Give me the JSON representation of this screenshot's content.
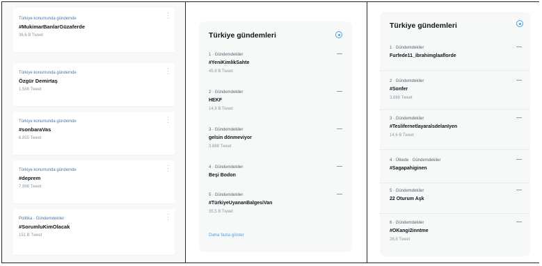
{
  "panel1": {
    "cards": [
      {
        "context": "Türkiye konumunda gündemde",
        "topic": "#MukimarBanlarGüzaferde",
        "count": "36,6 B Tweet"
      },
      {
        "context": "Türkiye konumunda gündemde",
        "topic": "Özgür Demirtaş",
        "count": "1.588 Tweet"
      },
      {
        "context": "Türkiye konumunda gündemde",
        "topic": "#sonbaraVas",
        "count": "6.855 Tweet"
      },
      {
        "context": "Türkiye konumunda gündemde",
        "topic": "#deprem",
        "count": "7.986 Tweet"
      },
      {
        "context": "Politika · Gündemdekiler",
        "topic": "#SorumluKimOlacak",
        "count": "151 B Tweet"
      }
    ]
  },
  "panel2": {
    "header": "Türkiye gündemleri",
    "items": [
      {
        "context": "1 · Gündemdekiler",
        "topic": "#YeniKimlikSahte",
        "count": "45,8 B Tweet"
      },
      {
        "context": "2 · Gündemdekiler",
        "topic": "HEKF",
        "count": "14,8 B Tweet"
      },
      {
        "context": "3 · Gündemdekiler",
        "topic": "gelsin dönmeviyor",
        "count": "3.888 Tweet"
      },
      {
        "context": "4 · Gündemdekiler",
        "topic": "Beşi Bodon",
        "count": ""
      },
      {
        "context": "5 · Gündemdekiler",
        "topic": "#TürkiyeUyananBalgesiVan",
        "count": "35,5 B Tweet"
      }
    ],
    "show_more": "Daha fazla göster"
  },
  "panel3": {
    "header": "Türkiye gündemleri",
    "items": [
      {
        "context": "1 · Gündemdekiler",
        "topic": "Furfede11_ibrahimglaaflorde",
        "count": ""
      },
      {
        "context": "2 · Gündemdekiler",
        "topic": "#Sonfer",
        "count": "3.888 Tweet"
      },
      {
        "context": "3 · Gündemdekiler",
        "topic": "#TeslifernetlayaralsdelanIyen",
        "count": "14,6 B Tweet"
      },
      {
        "context": "4 · Ülkede · Gündemdekiler",
        "topic": "#Sagapahiginen",
        "count": ""
      },
      {
        "context": "5 · Gündemdekiler",
        "topic": "22 Oturum Aşk",
        "count": ""
      },
      {
        "context": "6 · Gündemdekiler",
        "topic": "#OKangi2inntme",
        "count": "28,8 Tweet"
      }
    ]
  },
  "colors": {
    "accent": "#4a9ee8",
    "panel_bg": "#f7f9f9",
    "muted_text": "#536471"
  }
}
